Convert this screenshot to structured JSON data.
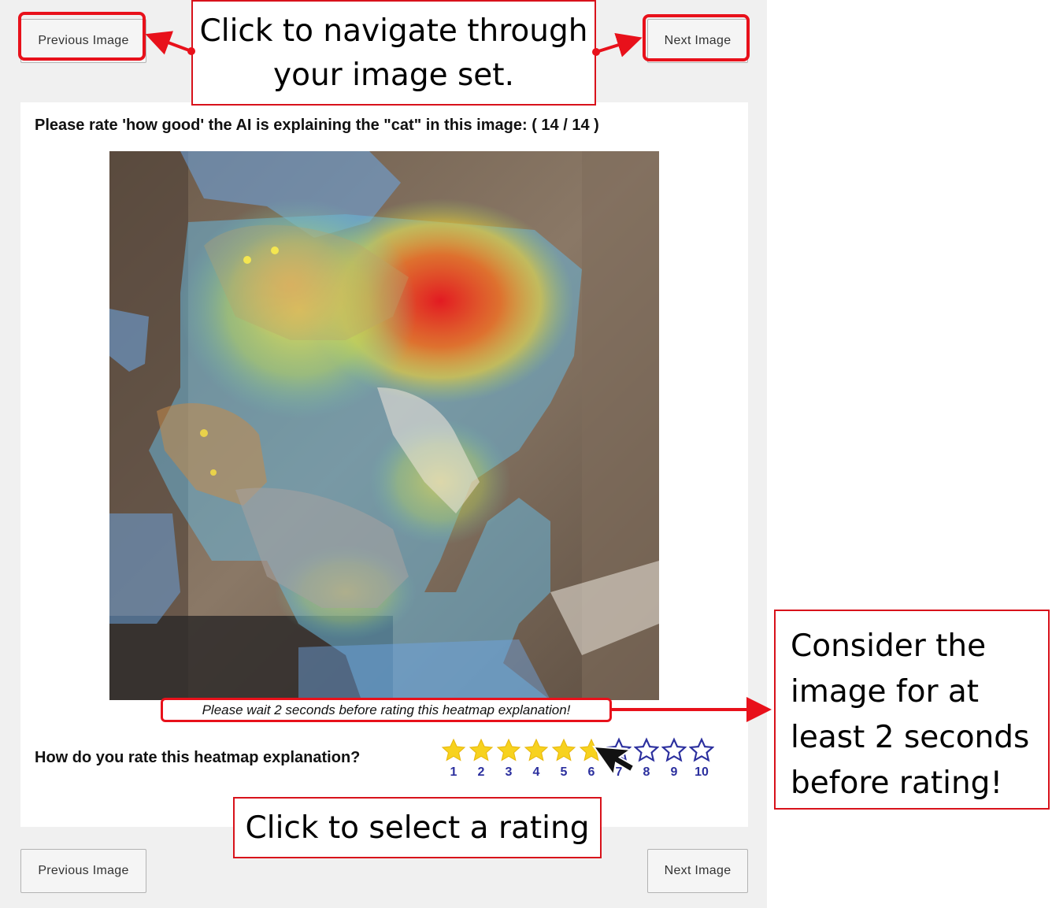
{
  "nav": {
    "prev_label": "Previous Image",
    "next_label": "Next Image"
  },
  "question": "Please rate 'how good' the AI is explaining the \"cat\" in this image: ( 14 / 14 )",
  "wait_note": "Please wait 2 seconds before rating this heatmap explanation!",
  "rating": {
    "question": "How do you rate this heatmap explanation?",
    "scale": [
      "1",
      "2",
      "3",
      "4",
      "5",
      "6",
      "7",
      "8",
      "9",
      "10"
    ],
    "selected": 6,
    "filled_color": "#f7d21e",
    "empty_color": "#2b2f9e"
  },
  "callouts": {
    "navigate": "Click to navigate through your image set.",
    "select_rating": "Click to select a rating",
    "consider": "Consider the image for at least 2 seconds before rating!"
  },
  "colors": {
    "highlight": "#e8111b",
    "panel_bg": "#f0f0f0"
  }
}
